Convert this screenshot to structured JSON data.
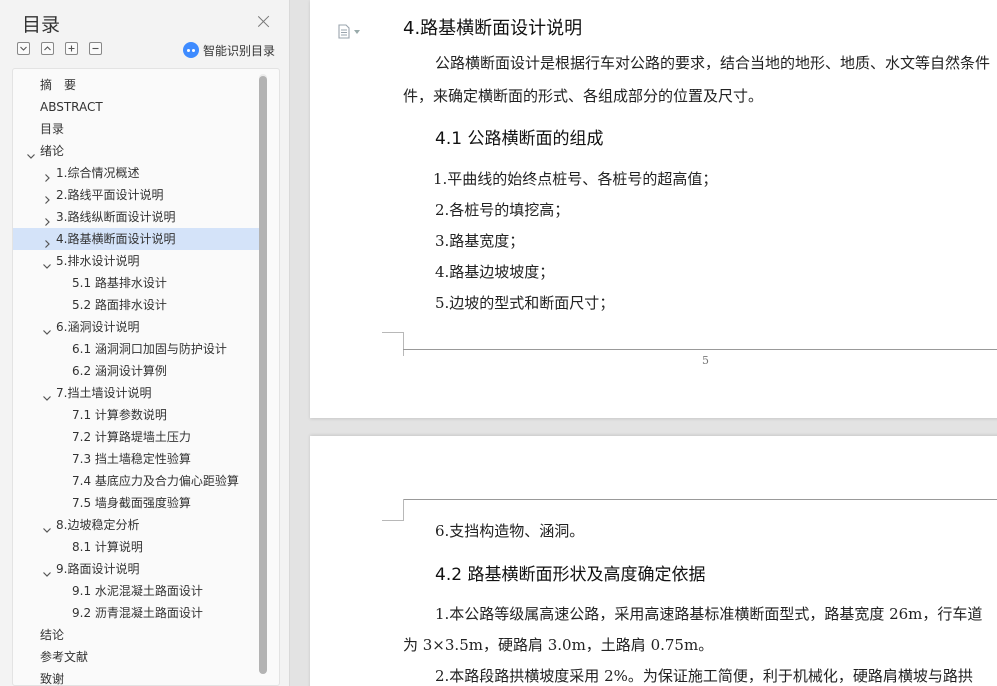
{
  "sidebar": {
    "title": "目录",
    "smart_toc_label": "智能识别目录",
    "toolbar": [
      "collapse-all",
      "expand-all",
      "add-heading",
      "remove-heading"
    ],
    "items": [
      {
        "label": "摘　要",
        "level": 0,
        "chevron": "none"
      },
      {
        "label": "ABSTRACT",
        "level": 0,
        "chevron": "none"
      },
      {
        "label": "目录",
        "level": 0,
        "chevron": "none"
      },
      {
        "label": "绪论",
        "level": 0,
        "chevron": "down"
      },
      {
        "label": "1.综合情况概述",
        "level": 1,
        "chevron": "right"
      },
      {
        "label": "2.路线平面设计说明",
        "level": 1,
        "chevron": "right"
      },
      {
        "label": "3.路线纵断面设计说明",
        "level": 1,
        "chevron": "right"
      },
      {
        "label": "4.路基横断面设计说明",
        "level": 1,
        "chevron": "right",
        "selected": true
      },
      {
        "label": "5.排水设计说明",
        "level": 1,
        "chevron": "down"
      },
      {
        "label": "5.1  路基排水设计",
        "level": 2,
        "chevron": "none"
      },
      {
        "label": "5.2  路面排水设计",
        "level": 2,
        "chevron": "none"
      },
      {
        "label": "6.涵洞设计说明",
        "level": 1,
        "chevron": "down"
      },
      {
        "label": "6.1  涵洞洞口加固与防护设计",
        "level": 2,
        "chevron": "none"
      },
      {
        "label": "6.2  涵洞设计算例",
        "level": 2,
        "chevron": "none"
      },
      {
        "label": "7.挡土墙设计说明",
        "level": 1,
        "chevron": "down"
      },
      {
        "label": "7.1 计算参数说明",
        "level": 2,
        "chevron": "none"
      },
      {
        "label": "7.2 计算路堤墙土压力",
        "level": 2,
        "chevron": "none"
      },
      {
        "label": "7.3 挡土墙稳定性验算",
        "level": 2,
        "chevron": "none"
      },
      {
        "label": "7.4 基底应力及合力偏心距验算",
        "level": 2,
        "chevron": "none"
      },
      {
        "label": "7.5 墙身截面强度验算",
        "level": 2,
        "chevron": "none"
      },
      {
        "label": "8.边坡稳定分析",
        "level": 1,
        "chevron": "down"
      },
      {
        "label": "8.1 计算说明",
        "level": 2,
        "chevron": "none"
      },
      {
        "label": "9.路面设计说明",
        "level": 1,
        "chevron": "down"
      },
      {
        "label": "9.1  水泥混凝土路面设计",
        "level": 2,
        "chevron": "none"
      },
      {
        "label": "9.2  沥青混凝土路面设计",
        "level": 2,
        "chevron": "none"
      },
      {
        "label": "结论",
        "level": 0,
        "chevron": "none"
      },
      {
        "label": "参考文献",
        "level": 0,
        "chevron": "none"
      },
      {
        "label": "致谢",
        "level": 0,
        "chevron": "none"
      }
    ]
  },
  "colors": {
    "accent": "#3e8bff",
    "selected_bg": "#d4e3f9"
  },
  "page1": {
    "heading": "4.路基横断面设计说明",
    "intro_line1": "公路横断面设计是根据行车对公路的要求，结合当地的地形、地质、水文等自然条件",
    "intro_line2": "件，来确定横断面的形式、各组成部分的位置及尺寸。",
    "subheading": "4.1  公路横断面的组成",
    "items": [
      "1.平曲线的始终点桩号、各桩号的超高值；",
      "2.各桩号的填挖高；",
      "3.路基宽度；",
      "4.路基边坡坡度；",
      "5.边坡的型式和断面尺寸；"
    ],
    "page_number": "5"
  },
  "page2": {
    "item6": "6.支挡构造物、涵洞。",
    "subheading": "4.2  路基横断面形状及高度确定依据",
    "para1_line1": "1.本公路等级属高速公路，采用高速路基标准横断面型式，路基宽度 26m，行车道",
    "para1_line2": "为 3×3.5m，硬路肩 3.0m，土路肩 0.75m。",
    "para2_line1": "2.本路段路拱横坡度采用 2%。为保证施工简便，利于机械化，硬路肩横坡与路拱"
  }
}
